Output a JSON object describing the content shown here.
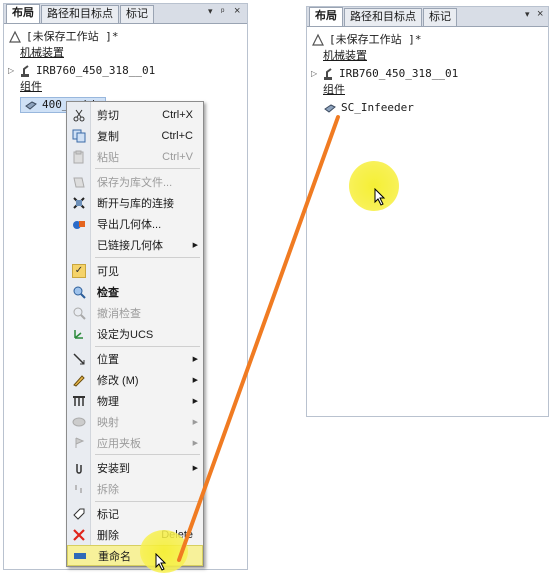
{
  "left_panel": {
    "tabs": [
      {
        "label": "布局",
        "active": true
      },
      {
        "label": "路径和目标点",
        "active": false
      },
      {
        "label": "标记",
        "active": false
      }
    ],
    "controls": {
      "dropdown": "▾",
      "pin": "ᵖ",
      "close": "×"
    },
    "station": "[未保存工作站 ]*",
    "mechanisms_heading": "机械装置",
    "robot": "IRB760_450_318__01",
    "components_heading": "组件",
    "component_selected": "400_guide"
  },
  "right_panel": {
    "tabs": [
      {
        "label": "布局",
        "active": true
      },
      {
        "label": "路径和目标点",
        "active": false
      },
      {
        "label": "标记",
        "active": false
      }
    ],
    "controls": {
      "dropdown": "▾",
      "close": "×"
    },
    "station": "[未保存工作站 ]*",
    "mechanisms_heading": "机械装置",
    "robot": "IRB760_450_318__01",
    "components_heading": "组件",
    "component_renamed": "SC_Infeeder"
  },
  "context_menu": {
    "items": [
      {
        "label": "剪切",
        "shortcut": "Ctrl+X",
        "icon": "scissors-icon",
        "disabled": false
      },
      {
        "label": "复制",
        "shortcut": "Ctrl+C",
        "icon": "copy-icon",
        "disabled": false
      },
      {
        "label": "粘贴",
        "shortcut": "Ctrl+V",
        "icon": "paste-icon",
        "disabled": true
      },
      {
        "label": "保存为库文件...",
        "icon": "save-library-icon",
        "disabled": true
      },
      {
        "label": "断开与库的连接",
        "icon": "disconnect-library-icon",
        "disabled": false
      },
      {
        "label": "导出几何体...",
        "icon": "export-geometry-icon",
        "disabled": false
      },
      {
        "label": "已链接几何体",
        "icon": "",
        "disabled": false,
        "submenu": true
      },
      {
        "label": "可见",
        "icon": "checkmark-icon",
        "disabled": false,
        "checked": true
      },
      {
        "label": "检查",
        "icon": "inspect-icon",
        "disabled": false,
        "bold": true
      },
      {
        "label": "撤消检查",
        "icon": "undo-inspect-icon",
        "disabled": true
      },
      {
        "label": "设定为UCS",
        "icon": "set-ucs-icon",
        "disabled": false
      },
      {
        "label": "位置",
        "icon": "position-icon",
        "disabled": false,
        "submenu": true
      },
      {
        "label": "修改 (M)",
        "icon": "modify-icon",
        "disabled": false,
        "submenu": true
      },
      {
        "label": "物理",
        "icon": "physics-icon",
        "disabled": false,
        "submenu": true
      },
      {
        "label": "映射",
        "icon": "mapping-icon",
        "disabled": true,
        "submenu": true
      },
      {
        "label": "应用夹板",
        "icon": "apply-fixture-icon",
        "disabled": true,
        "submenu": true
      },
      {
        "label": "安装到",
        "icon": "attach-icon",
        "disabled": false,
        "submenu": true
      },
      {
        "label": "拆除",
        "icon": "detach-icon",
        "disabled": true
      },
      {
        "label": "标记",
        "icon": "tag-icon",
        "disabled": false
      },
      {
        "label": "删除",
        "shortcut": "Delete",
        "icon": "delete-icon",
        "disabled": false
      },
      {
        "label": "重命名",
        "icon": "rename-icon",
        "disabled": false,
        "hovered": true
      }
    ]
  },
  "colors": {
    "annotation_arrow": "#f07b22",
    "cursor_highlight": "#f4ee2a",
    "menu_hover": "#f7f19a"
  }
}
